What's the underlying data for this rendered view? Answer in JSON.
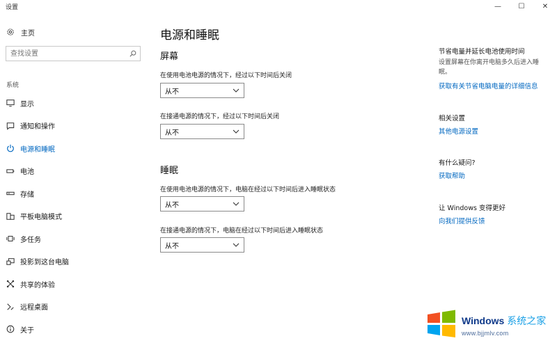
{
  "window": {
    "title": "设置",
    "minimize_glyph": "—",
    "maximize_glyph": "☐",
    "close_glyph": "✕"
  },
  "sidebar": {
    "home_label": "主页",
    "search_placeholder": "查找设置",
    "section_label": "系统",
    "items": [
      {
        "label": "显示",
        "icon": "display-icon"
      },
      {
        "label": "通知和操作",
        "icon": "notification-icon"
      },
      {
        "label": "电源和睡眠",
        "icon": "power-icon",
        "active": true
      },
      {
        "label": "电池",
        "icon": "battery-icon"
      },
      {
        "label": "存储",
        "icon": "storage-icon"
      },
      {
        "label": "平板电脑模式",
        "icon": "tablet-icon"
      },
      {
        "label": "多任务",
        "icon": "multitask-icon"
      },
      {
        "label": "投影到这台电脑",
        "icon": "project-icon"
      },
      {
        "label": "共享的体验",
        "icon": "share-icon"
      },
      {
        "label": "远程桌面",
        "icon": "remote-desktop-icon"
      },
      {
        "label": "关于",
        "icon": "info-icon"
      }
    ]
  },
  "main": {
    "title": "电源和睡眠",
    "screen": {
      "heading": "屏幕",
      "battery_label": "在使用电池电源的情况下，经过以下时间后关闭",
      "battery_value": "从不",
      "plugged_label": "在接通电源的情况下，经过以下时间后关闭",
      "plugged_value": "从不"
    },
    "sleep": {
      "heading": "睡眠",
      "battery_label": "在使用电池电源的情况下，电脑在经过以下时间后进入睡眠状态",
      "battery_value": "从不",
      "plugged_label": "在接通电源的情况下，电脑在经过以下时间后进入睡眠状态",
      "plugged_value": "从不"
    }
  },
  "right": {
    "save_heading": "节省电量并延长电池使用时间",
    "save_text": "设置屏幕在你离开电脑多久后进入睡眠。",
    "save_link": "获取有关节省电脑电量的详细信息",
    "related_heading": "相关设置",
    "related_link": "其他电源设置",
    "question_heading": "有什么疑问?",
    "question_link": "获取帮助",
    "feedback_heading": "让 Windows 变得更好",
    "feedback_link": "向我们提供反馈"
  },
  "watermark": {
    "brand": "Windows",
    "brand_cn": "系统之家",
    "url": "www.bjjmlv.com"
  },
  "colors": {
    "accent": "#0067c0",
    "text": "#1a1a1a",
    "muted": "#555555"
  }
}
